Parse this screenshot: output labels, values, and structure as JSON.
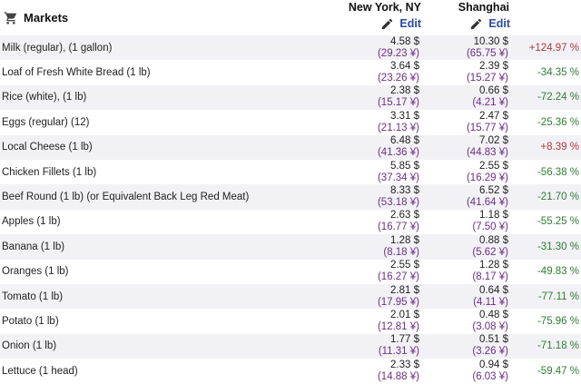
{
  "header": {
    "section_title": "Markets",
    "city1": "New York, NY",
    "city2": "Shanghai",
    "edit_label": "Edit"
  },
  "colors": {
    "negative": "#2e7d32",
    "positive": "#b03a3a",
    "cny": "#6b2f86",
    "link": "#2a4aa0"
  },
  "icons": {
    "section": "shopping-cart-icon",
    "edit": "pencil-icon"
  },
  "rows": [
    {
      "item": "Milk (regular), (1 gallon)",
      "ny_usd": "4.58 $",
      "ny_cny": "(29.23 ¥)",
      "sh_usd": "10.30 $",
      "sh_cny": "(65.75 ¥)",
      "diff": "+124.97 %",
      "dir": "pos"
    },
    {
      "item": "Loaf of Fresh White Bread (1 lb)",
      "ny_usd": "3.64 $",
      "ny_cny": "(23.26 ¥)",
      "sh_usd": "2.39 $",
      "sh_cny": "(15.27 ¥)",
      "diff": "-34.35 %",
      "dir": "neg"
    },
    {
      "item": "Rice (white), (1 lb)",
      "ny_usd": "2.38 $",
      "ny_cny": "(15.17 ¥)",
      "sh_usd": "0.66 $",
      "sh_cny": "(4.21 ¥)",
      "diff": "-72.24 %",
      "dir": "neg"
    },
    {
      "item": "Eggs (regular) (12)",
      "ny_usd": "3.31 $",
      "ny_cny": "(21.13 ¥)",
      "sh_usd": "2.47 $",
      "sh_cny": "(15.77 ¥)",
      "diff": "-25.36 %",
      "dir": "neg"
    },
    {
      "item": "Local Cheese (1 lb)",
      "ny_usd": "6.48 $",
      "ny_cny": "(41.36 ¥)",
      "sh_usd": "7.02 $",
      "sh_cny": "(44.83 ¥)",
      "diff": "+8.39 %",
      "dir": "pos"
    },
    {
      "item": "Chicken Fillets (1 lb)",
      "ny_usd": "5.85 $",
      "ny_cny": "(37.34 ¥)",
      "sh_usd": "2.55 $",
      "sh_cny": "(16.29 ¥)",
      "diff": "-56.38 %",
      "dir": "neg"
    },
    {
      "item": "Beef Round (1 lb) (or Equivalent Back Leg Red Meat)",
      "ny_usd": "8.33 $",
      "ny_cny": "(53.18 ¥)",
      "sh_usd": "6.52 $",
      "sh_cny": "(41.64 ¥)",
      "diff": "-21.70 %",
      "dir": "neg"
    },
    {
      "item": "Apples (1 lb)",
      "ny_usd": "2.63 $",
      "ny_cny": "(16.77 ¥)",
      "sh_usd": "1.18 $",
      "sh_cny": "(7.50 ¥)",
      "diff": "-55.25 %",
      "dir": "neg"
    },
    {
      "item": "Banana (1 lb)",
      "ny_usd": "1.28 $",
      "ny_cny": "(8.18 ¥)",
      "sh_usd": "0.88 $",
      "sh_cny": "(5.62 ¥)",
      "diff": "-31.30 %",
      "dir": "neg"
    },
    {
      "item": "Oranges (1 lb)",
      "ny_usd": "2.55 $",
      "ny_cny": "(16.27 ¥)",
      "sh_usd": "1.28 $",
      "sh_cny": "(8.17 ¥)",
      "diff": "-49.83 %",
      "dir": "neg"
    },
    {
      "item": "Tomato (1 lb)",
      "ny_usd": "2.81 $",
      "ny_cny": "(17.95 ¥)",
      "sh_usd": "0.64 $",
      "sh_cny": "(4.11 ¥)",
      "diff": "-77.11 %",
      "dir": "neg"
    },
    {
      "item": "Potato (1 lb)",
      "ny_usd": "2.01 $",
      "ny_cny": "(12.81 ¥)",
      "sh_usd": "0.48 $",
      "sh_cny": "(3.08 ¥)",
      "diff": "-75.96 %",
      "dir": "neg"
    },
    {
      "item": "Onion (1 lb)",
      "ny_usd": "1.77 $",
      "ny_cny": "(11.31 ¥)",
      "sh_usd": "0.51 $",
      "sh_cny": "(3.26 ¥)",
      "diff": "-71.18 %",
      "dir": "neg"
    },
    {
      "item": "Lettuce (1 head)",
      "ny_usd": "2.33 $",
      "ny_cny": "(14.88 ¥)",
      "sh_usd": "0.94 $",
      "sh_cny": "(6.03 ¥)",
      "diff": "-59.47 %",
      "dir": "neg"
    }
  ]
}
